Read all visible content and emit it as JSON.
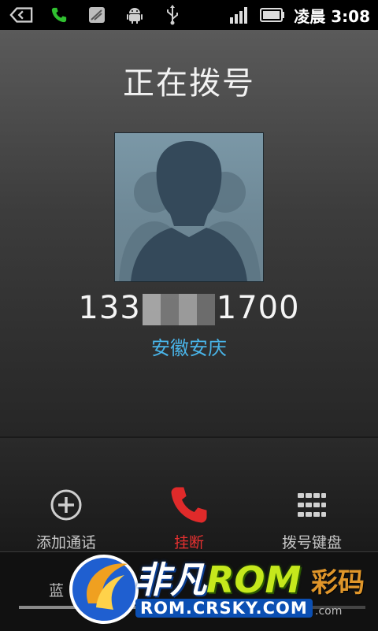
{
  "status_bar": {
    "time": "凌晨 3:08",
    "icons": [
      "back-arrow-icon",
      "phone-call-icon",
      "sms-icon",
      "android-debug-icon",
      "usb-icon",
      "signal-icon",
      "battery-icon"
    ]
  },
  "call": {
    "title": "正在拨号",
    "number_prefix": "133",
    "number_suffix": "1700",
    "location": "安徽安庆"
  },
  "controls": {
    "add_call": "添加通话",
    "hang_up": "挂断",
    "dialpad": "拨号键盘"
  },
  "bottom": {
    "bluetooth_partial": "蓝"
  },
  "watermark": {
    "brand_a": "非凡",
    "brand_b": "ROM",
    "url": "ROM.CRSKY.COM",
    "side_text": "彩码",
    "side_url": ".com"
  },
  "colors": {
    "location": "#49b4e8",
    "hang_up": "#e53030",
    "call_icon": "#30c030"
  }
}
